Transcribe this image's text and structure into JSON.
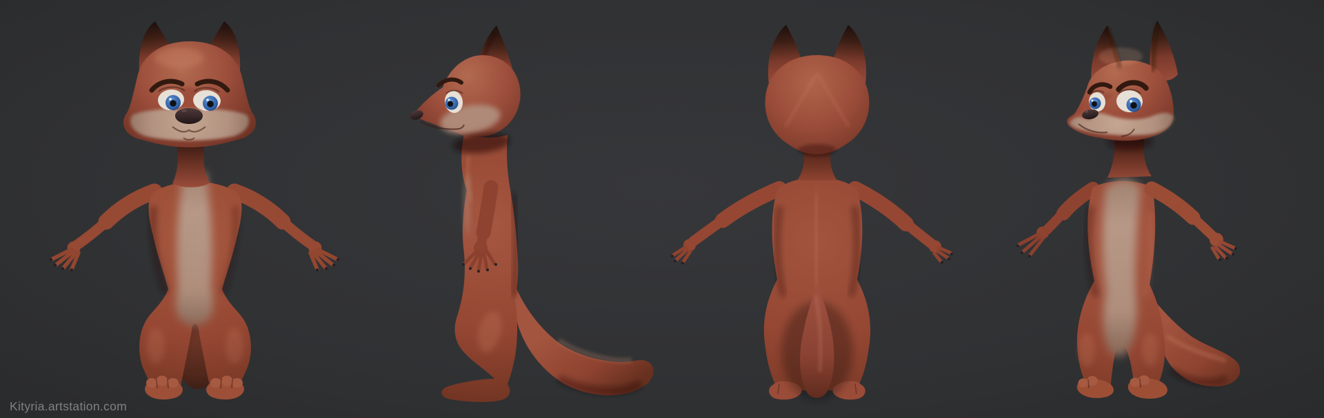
{
  "watermark": {
    "text": "Kityria.artstation.com",
    "color": "#97999c"
  },
  "scene": {
    "background": "#303133",
    "subject": "stylized cartoon fox character 3D sculpt turnaround",
    "views": [
      "front",
      "side",
      "back",
      "three-quarter"
    ]
  },
  "palette": {
    "fur_main": "#9a4c3a",
    "fur_highlight": "#b26a50",
    "fur_shadow": "#5f2b20",
    "belly_cream": "#b29180",
    "ear_tip_dark": "#1c0f0d",
    "iris_blue": "#3a6cb5",
    "sclera": "#e6e0d6",
    "nose_dark": "#2b1e1f",
    "claw_dark": "#262127"
  }
}
